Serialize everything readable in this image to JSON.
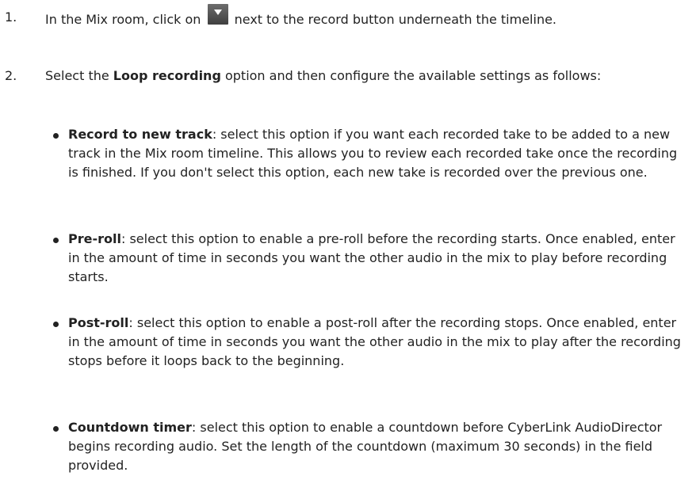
{
  "steps": [
    {
      "number": "1.",
      "text_before": "In the Mix room, click on",
      "icon": "dropdown-arrow-icon",
      "text_after": "next to the record button underneath the timeline."
    },
    {
      "number": "2.",
      "text_before": "Select the ",
      "bold": "Loop recording",
      "text_after": " option and then configure the available settings as follows:"
    }
  ],
  "bullets": [
    {
      "term": "Record to new track",
      "desc": ": select this option if you want each recorded take to be added to a new track in the Mix room timeline. This allows you to review each recorded take once the recording is finished. If you don't select this option, each new take is recorded over the previous one."
    },
    {
      "term": "Pre-roll",
      "desc": ": select this option to enable a pre-roll before the recording starts. Once enabled, enter in the amount of time in seconds you want the other audio in the mix to play before recording starts."
    },
    {
      "term": "Post-roll",
      "desc": ": select this option to enable a post-roll after the recording stops. Once enabled, enter in the amount of time in seconds you want the other audio in the mix to play after the recording stops before it loops back to the beginning."
    },
    {
      "term": "Countdown timer",
      "desc": ": select this option to enable a countdown before CyberLink AudioDirector begins recording audio. Set the length of the countdown (maximum 30 seconds) in the field provided."
    }
  ],
  "colors": {
    "text": "#222222",
    "icon_bg": "#555555",
    "icon_arrow": "#ffffff"
  }
}
